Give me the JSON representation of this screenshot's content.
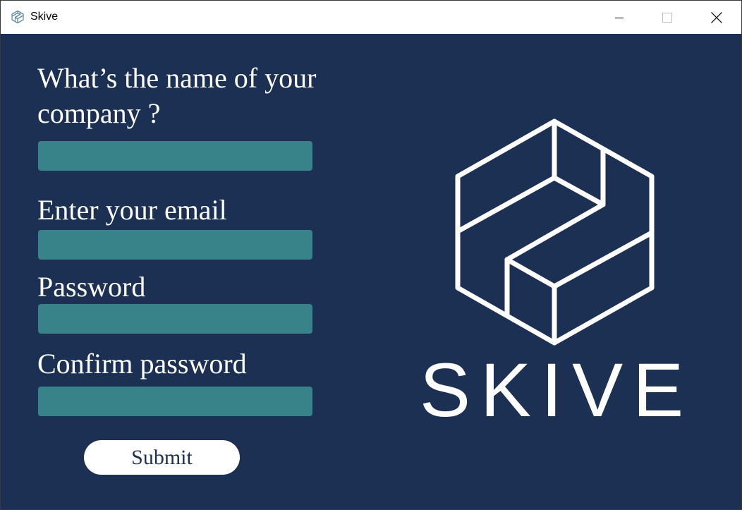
{
  "window": {
    "title": "Skive",
    "app_icon": "skive-logo-icon",
    "controls": [
      "minimize-icon",
      "maximize-icon",
      "close-icon"
    ]
  },
  "form": {
    "company_label": "What’s the name of your company ?",
    "company_value": "",
    "email_label": "Enter your email",
    "email_value": "",
    "password_label": "Password",
    "password_value": "",
    "confirm_label": "Confirm password",
    "confirm_value": "",
    "submit_label": "Submit"
  },
  "brand": {
    "name": "SKIVE",
    "logo_icon": "skive-hexagon-logo-icon"
  },
  "colors": {
    "background": "#1b3053",
    "field": "#38838a",
    "text": "#ffffff",
    "button": "#ffffff",
    "button_text": "#1b3053"
  }
}
